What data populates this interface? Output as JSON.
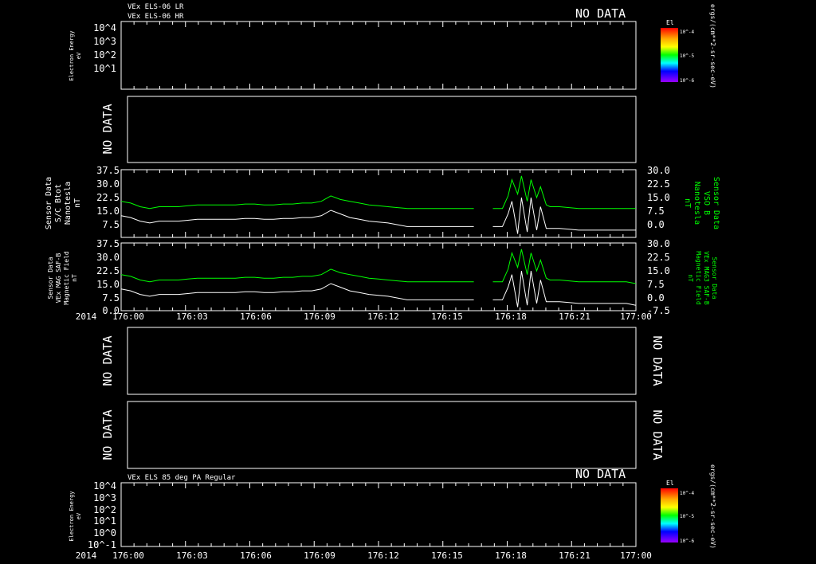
{
  "colors": {
    "background": "#000000",
    "foreground": "#ffffff",
    "mag_sensor": "#00ff00",
    "mag_total": "#ffffff"
  },
  "time_axis": {
    "year": "2014",
    "ticks": [
      "176:00",
      "176:03",
      "176:06",
      "176:09",
      "176:12",
      "176:15",
      "176:18",
      "176:21",
      "177:00"
    ]
  },
  "no_data": "NO DATA",
  "panel_els_top": {
    "titles": [
      "VEx ELS-06 LR",
      "VEx ELS-06 HR"
    ],
    "ylabel": [
      "Electron Energy",
      "eV"
    ],
    "yticks": [
      "10^4",
      "10^3",
      "10^2",
      "10^1"
    ],
    "colorbar_title": "El",
    "colorbar_ticks": [
      "10^-4",
      "10^-5",
      "10^-6"
    ],
    "colorbar_units": "ergs/(cm**2-sr-sec-eV)"
  },
  "panel_els_bottom": {
    "title": "VEx ELS 85 deg PA Regular",
    "ylabel": [
      "Electron Energy",
      "eV"
    ],
    "yticks": [
      "10^4",
      "10^3",
      "10^2",
      "10^1",
      "10^0",
      "10^-1"
    ],
    "colorbar_title": "El",
    "colorbar_ticks": [
      "10^-4",
      "10^-5",
      "10^-6"
    ],
    "colorbar_units": "ergs/(cm**2-sr-sec-eV)"
  },
  "chart_data": [
    {
      "type": "line",
      "left_axis": {
        "label": [
          "Sensor Data",
          "S/C Btot",
          "Nanotesla",
          "nT"
        ],
        "ticks": [
          "37.5",
          "30.0",
          "22.5",
          "15.0",
          "7.5"
        ],
        "ylim": [
          0,
          37.5
        ]
      },
      "right_axis": {
        "label": [
          "Sensor Data",
          "VSO B",
          "Nanotesla",
          "nT"
        ],
        "ticks": [
          "30.0",
          "22.5",
          "15.0",
          "7.5",
          "0.0"
        ],
        "ylim": [
          -7.5,
          30.0
        ]
      },
      "x_minutes": [
        0,
        0.5,
        1,
        1.5,
        2,
        2.5,
        3,
        3.5,
        4,
        4.5,
        5,
        5.5,
        6,
        6.5,
        7,
        7.5,
        8,
        8.5,
        9,
        9.5,
        10,
        10.5,
        11,
        11.5,
        12,
        12.5,
        13,
        13.5,
        14,
        14.5,
        15,
        15.5,
        16,
        16.5,
        17,
        17.5,
        18,
        18.5,
        19,
        19.5,
        20,
        20.3,
        20.5,
        20.8,
        21,
        21.3,
        21.5,
        21.8,
        22,
        22.3,
        22.5,
        23,
        23.5,
        24,
        24.5,
        25,
        25.5,
        26,
        26.5,
        27
      ],
      "series": [
        {
          "name": "S/C Btot",
          "axis": "left",
          "values": [
            20,
            19,
            17,
            16,
            17,
            17,
            17,
            17.5,
            18,
            18,
            18,
            18,
            18,
            18.5,
            18.5,
            18,
            18,
            18.5,
            18.5,
            19,
            19,
            20,
            23,
            21,
            20,
            19,
            18,
            17.5,
            17,
            16.5,
            16,
            16,
            16,
            16,
            16,
            16,
            16,
            16,
            null,
            16,
            16,
            23,
            32,
            24,
            34,
            20,
            32,
            22,
            28,
            18,
            17,
            17,
            16.5,
            16,
            16,
            16,
            16,
            16,
            16,
            16
          ]
        },
        {
          "name": "VSO B",
          "axis": "left",
          "values": [
            12,
            11,
            9,
            8,
            9,
            9,
            9,
            9.5,
            10,
            10,
            10,
            10,
            10,
            10.5,
            10.5,
            10,
            10,
            10.5,
            10.5,
            11,
            11,
            12,
            15,
            13,
            11,
            10,
            9,
            8.5,
            8,
            7,
            6,
            6,
            6,
            6,
            6,
            6,
            6,
            6,
            null,
            6,
            6,
            13,
            20,
            2,
            22,
            3,
            22,
            4,
            17,
            5,
            5,
            5,
            4.5,
            4,
            4,
            4,
            4,
            4,
            4,
            4
          ]
        }
      ]
    },
    {
      "type": "line",
      "left_axis": {
        "label": [
          "Sensor Data",
          "VEx MAG SAF-B",
          "Magnetic Field",
          "nT"
        ],
        "ticks": [
          "37.5",
          "30.0",
          "22.5",
          "15.0",
          "7.5",
          "0.0"
        ],
        "ylim": [
          0,
          37.5
        ]
      },
      "right_axis": {
        "label": [
          "Sensor Data",
          "VEx MAG3 SAF-B",
          "Magnetic Field",
          "nT"
        ],
        "ticks": [
          "30.0",
          "22.5",
          "15.0",
          "7.5",
          "0.0",
          "-7.5"
        ],
        "ylim": [
          -7.5,
          30.0
        ]
      },
      "x_minutes": [
        0,
        0.5,
        1,
        1.5,
        2,
        2.5,
        3,
        3.5,
        4,
        4.5,
        5,
        5.5,
        6,
        6.5,
        7,
        7.5,
        8,
        8.5,
        9,
        9.5,
        10,
        10.5,
        11,
        11.5,
        12,
        12.5,
        13,
        13.5,
        14,
        14.5,
        15,
        15.5,
        16,
        16.5,
        17,
        17.5,
        18,
        18.5,
        19,
        19.5,
        20,
        20.3,
        20.5,
        20.8,
        21,
        21.3,
        21.5,
        21.8,
        22,
        22.3,
        22.5,
        23,
        23.5,
        24,
        24.5,
        25,
        25.5,
        26,
        26.5,
        27
      ],
      "series": [
        {
          "name": "S/C Btot",
          "axis": "left",
          "values": [
            20,
            19,
            17,
            16,
            17,
            17,
            17,
            17.5,
            18,
            18,
            18,
            18,
            18,
            18.5,
            18.5,
            18,
            18,
            18.5,
            18.5,
            19,
            19,
            20,
            23,
            21,
            20,
            19,
            18,
            17.5,
            17,
            16.5,
            16,
            16,
            16,
            16,
            16,
            16,
            16,
            16,
            null,
            16,
            16,
            23,
            32,
            24,
            34,
            20,
            32,
            22,
            28,
            18,
            17,
            17,
            16.5,
            16,
            16,
            16,
            16,
            16,
            16,
            15
          ]
        },
        {
          "name": "VSO B",
          "axis": "left",
          "values": [
            12,
            11,
            9,
            8,
            9,
            9,
            9,
            9.5,
            10,
            10,
            10,
            10,
            10,
            10.5,
            10.5,
            10,
            10,
            10.5,
            10.5,
            11,
            11,
            12,
            15,
            13,
            11,
            10,
            9,
            8.5,
            8,
            7,
            6,
            6,
            6,
            6,
            6,
            6,
            6,
            6,
            null,
            6,
            6,
            13,
            20,
            2,
            22,
            3,
            22,
            4,
            17,
            5,
            5,
            5,
            4.5,
            4,
            4,
            4,
            4,
            4,
            4,
            3
          ]
        }
      ]
    }
  ]
}
